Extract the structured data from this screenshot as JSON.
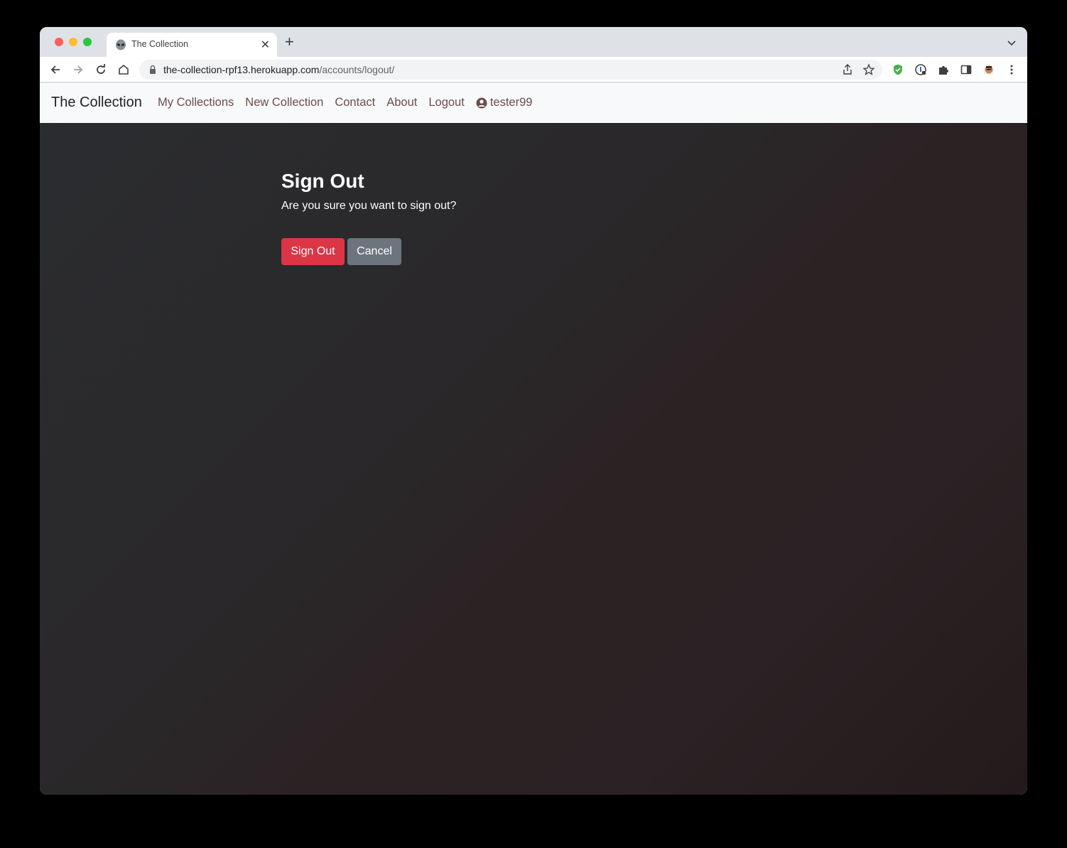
{
  "browser": {
    "tab_title": "The Collection",
    "new_tab_label": "+",
    "close_label": "✕",
    "url_host": "the-collection-rpf13.herokuapp.com",
    "url_path": "/accounts/logout/"
  },
  "navbar": {
    "brand": "The Collection",
    "links": [
      {
        "label": "My Collections"
      },
      {
        "label": "New Collection"
      },
      {
        "label": "Contact"
      },
      {
        "label": "About"
      },
      {
        "label": "Logout"
      }
    ],
    "user": "tester99"
  },
  "main": {
    "heading": "Sign Out",
    "message": "Are you sure you want to sign out?",
    "sign_out_button": "Sign Out",
    "cancel_button": "Cancel"
  },
  "colors": {
    "danger": "#dc3545",
    "secondary": "#6c757d",
    "nav_link": "#6c4d4a"
  }
}
